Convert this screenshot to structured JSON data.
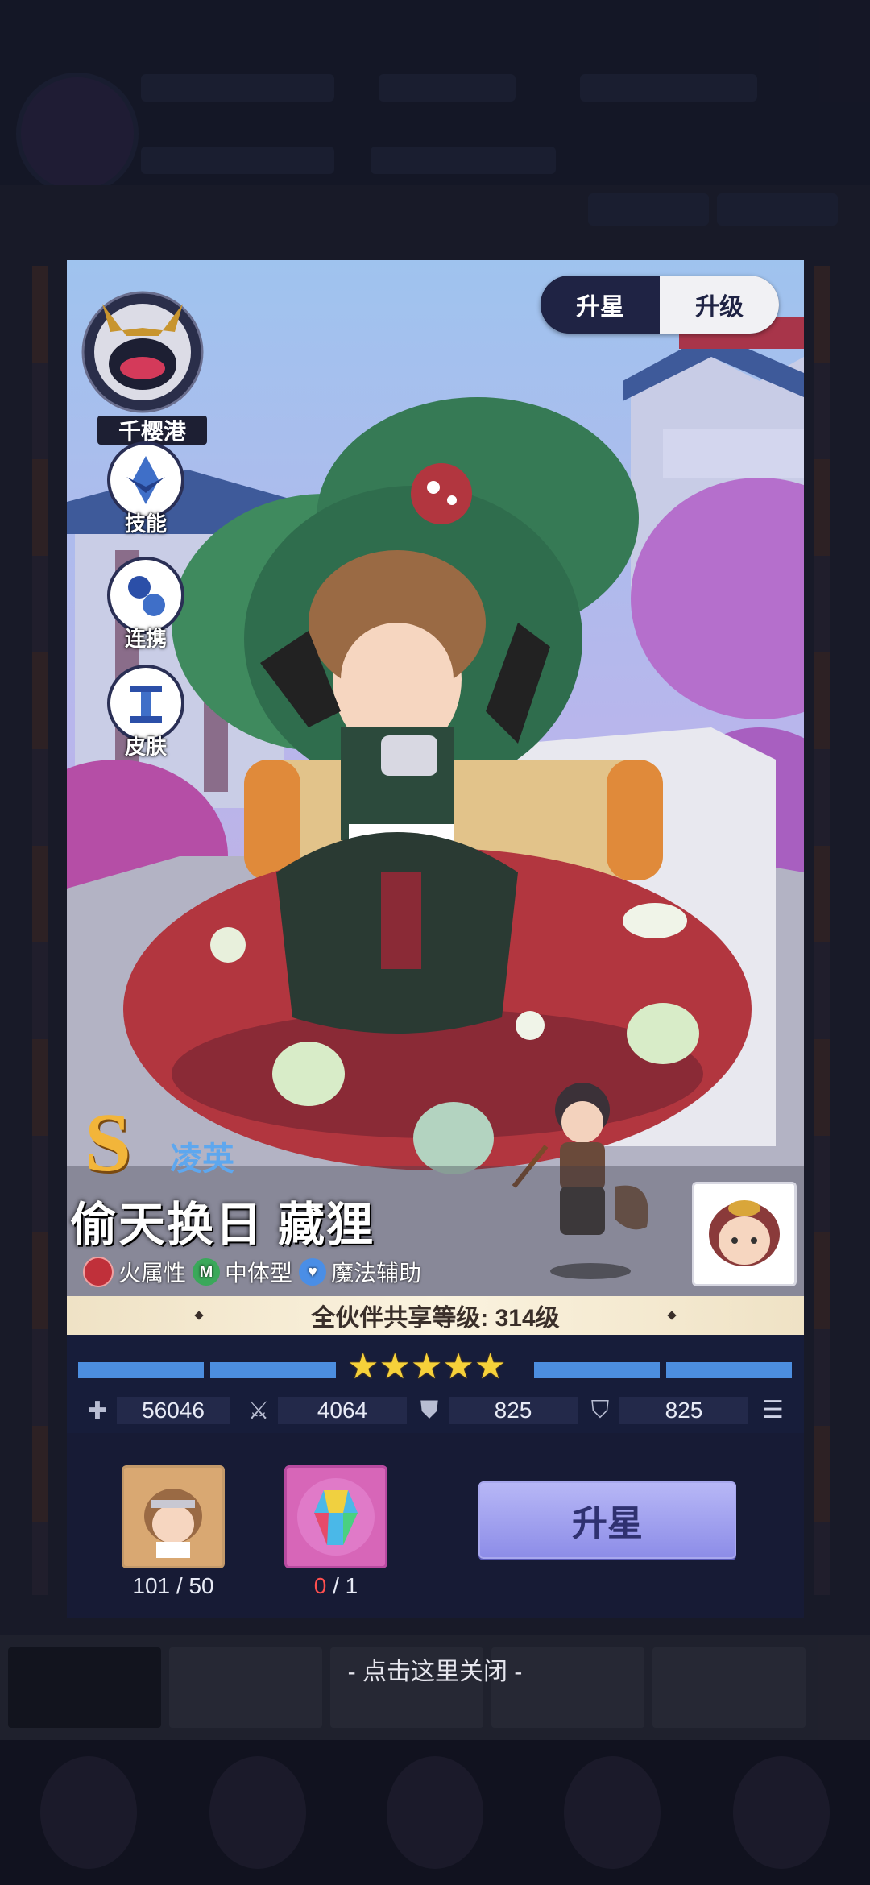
{
  "tabs": {
    "active": "升星",
    "inactive": "升级"
  },
  "region": {
    "name": "千樱港"
  },
  "side_menu": [
    {
      "label": "技能",
      "icon": "skill-icon"
    },
    {
      "label": "连携",
      "icon": "link-icon"
    },
    {
      "label": "皮肤",
      "icon": "skin-icon"
    }
  ],
  "character": {
    "rank": "S",
    "sub_name": "凌英",
    "title": "偷天换日 藏狸",
    "traits": [
      {
        "label": "火属性",
        "icon": "fire-icon",
        "color": "#c0303a"
      },
      {
        "label": "中体型",
        "icon": "medium-size-icon",
        "glyph": "M",
        "color": "#3aa85a"
      },
      {
        "label": "魔法辅助",
        "icon": "magic-support-icon",
        "color": "#4a8ee6"
      }
    ]
  },
  "shared_level": "全伙伴共享等级: 314级",
  "star_level": 5,
  "stats": [
    {
      "icon": "hp-icon",
      "value": "56046"
    },
    {
      "icon": "attack-sword-icon",
      "value": "4064"
    },
    {
      "icon": "physical-defense-icon",
      "value": "825"
    },
    {
      "icon": "magic-defense-icon",
      "value": "825"
    }
  ],
  "materials": [
    {
      "icon": "character-shard-icon",
      "have": "101",
      "need": "50",
      "count_text": "101 / 50"
    },
    {
      "icon": "rainbow-crystal-icon",
      "have": "0",
      "need": "1",
      "have_color": "#ff4f4f"
    }
  ],
  "upgrade_button": "升星",
  "close_hint": "- 点击这里关闭 -"
}
